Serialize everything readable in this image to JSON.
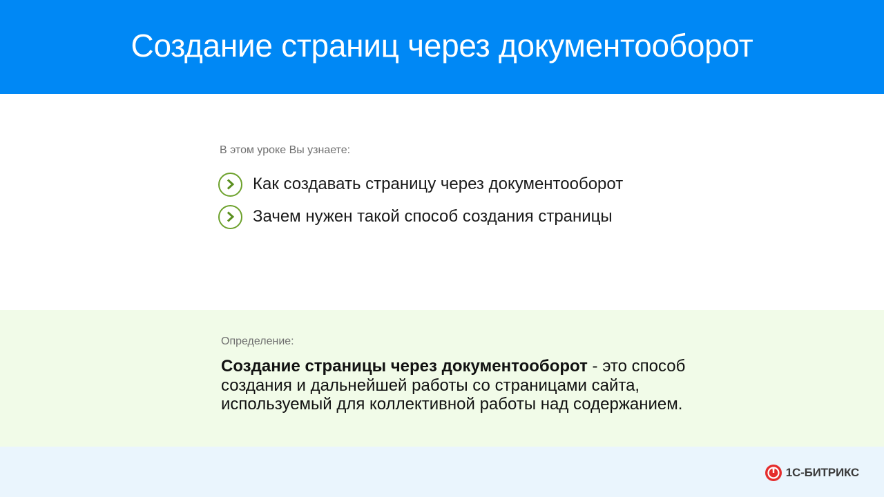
{
  "header": {
    "title": "Создание страниц через документооборот"
  },
  "learn": {
    "intro": "В этом уроке Вы узнаете:",
    "items": [
      {
        "text": "Как создавать страницу через документооборот"
      },
      {
        "text": "Зачем нужен такой способ создания страницы"
      }
    ]
  },
  "definition": {
    "label": "Определение:",
    "term": "Создание страницы через документооборот",
    "body": " - это способ создания и дальнейшей работы со страницами сайта, используемый для коллективной работы над содержанием."
  },
  "footer": {
    "logo_text": "1С-БИТРИКС"
  },
  "colors": {
    "header_bg": "#0088f5",
    "accent_green": "#6ca12b",
    "definition_bg": "#f1fbe8",
    "footer_bg": "#eaf5fd",
    "logo_red": "#e52d2d"
  },
  "icons": {
    "learn_item": "chevron-right-circle-icon",
    "logo": "bitrix-logo-icon"
  }
}
